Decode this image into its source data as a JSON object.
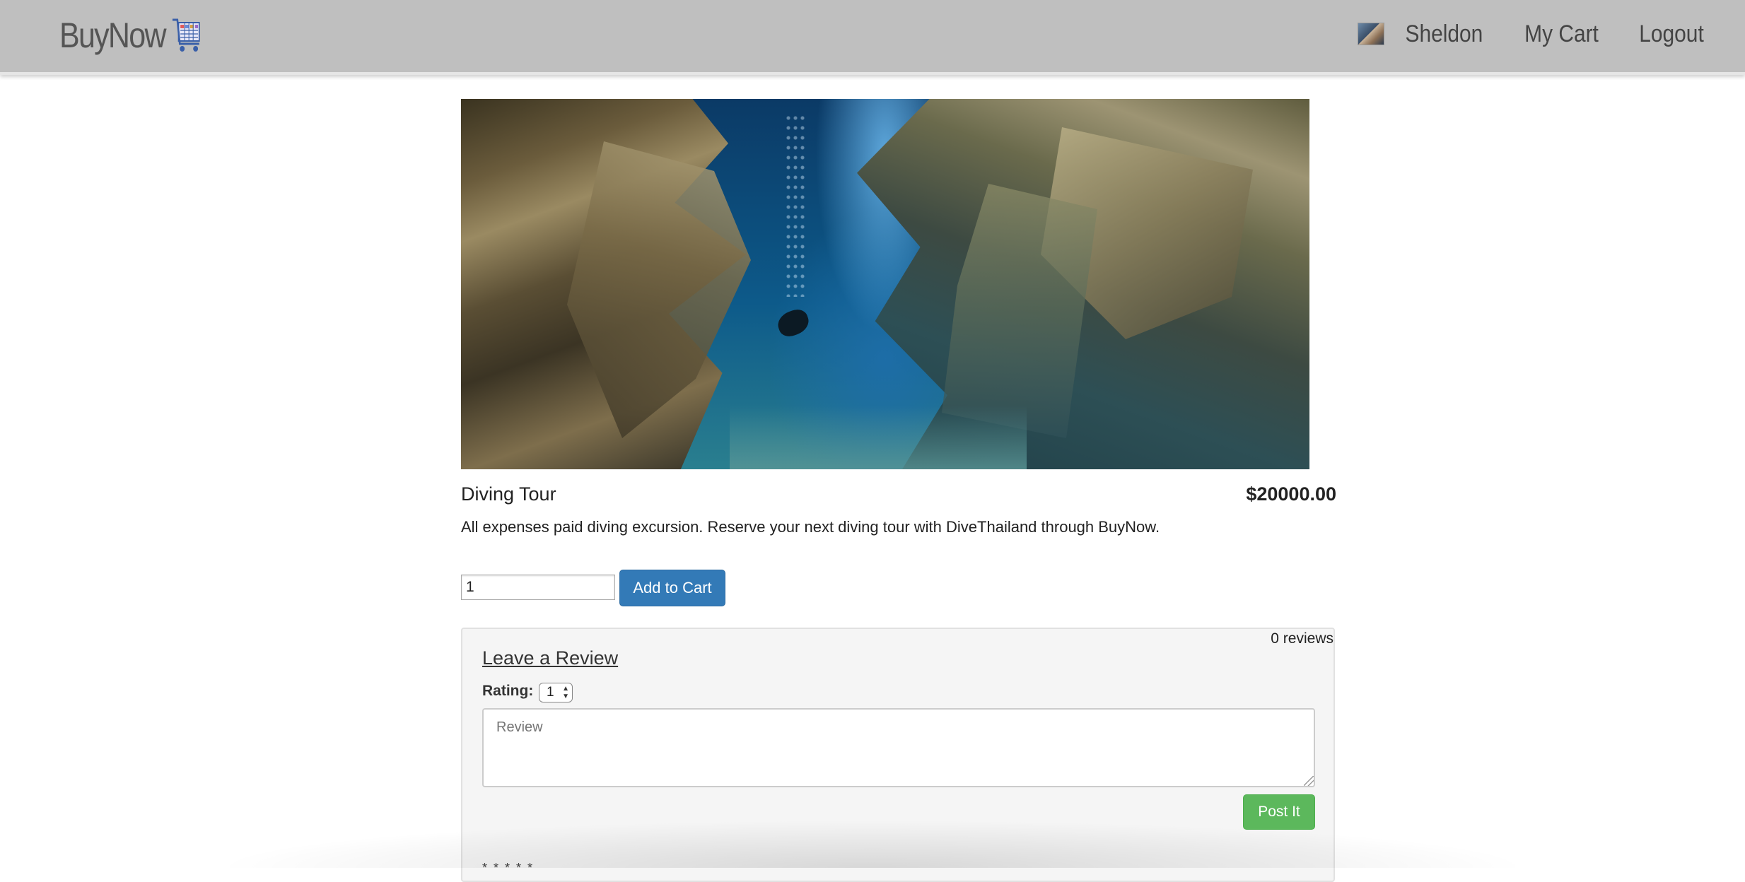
{
  "navbar": {
    "brand": "BuyNow",
    "brand_icon": "shopping-cart-icon",
    "user_name": "Sheldon",
    "cart_label": "My Cart",
    "logout_label": "Logout"
  },
  "product": {
    "image_alt": "underwater canyon with diver",
    "title": "Diving Tour",
    "price": "$20000.00",
    "description": "All expenses paid diving excursion. Reserve your next diving tour with DiveThailand through BuyNow."
  },
  "purchase": {
    "quantity": "1",
    "add_to_cart_label": "Add to Cart"
  },
  "review": {
    "count_text": "0 reviews",
    "heading": "Leave a Review",
    "rating_label": "Rating:",
    "rating_value": "1",
    "review_placeholder": "Review",
    "post_label": "Post It",
    "stars": "* * * * *"
  },
  "colors": {
    "navbar_bg": "#bfbfbf",
    "primary_button": "#337ab7",
    "success_button": "#5cb85c",
    "panel_bg": "#f5f5f5"
  }
}
